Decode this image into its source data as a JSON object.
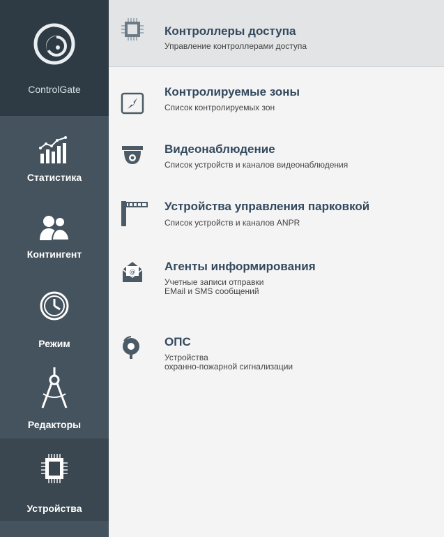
{
  "app": {
    "name": "ControlGate"
  },
  "sidebar": {
    "items": [
      {
        "label": "Статистика",
        "icon": "bar-chart-icon"
      },
      {
        "label": "Контингент",
        "icon": "people-icon"
      },
      {
        "label": "Режим",
        "icon": "clock-icon"
      },
      {
        "label": "Редакторы",
        "icon": "compass-icon"
      },
      {
        "label": "Устройства",
        "icon": "chip-icon",
        "active": true
      }
    ]
  },
  "main": {
    "items": [
      {
        "title": "Контроллеры доступа",
        "subtitle": [
          "Управление контроллерами доступа"
        ],
        "icon": "chip-icon",
        "selected": true
      },
      {
        "title": "Контролируемые зоны",
        "subtitle": [
          "Список контролируемых зон"
        ],
        "icon": "compass-icon"
      },
      {
        "title": "Видеонаблюдение",
        "subtitle": [
          "Список устройств и каналов видеонаблюдения"
        ],
        "icon": "camera-icon"
      },
      {
        "title": "Устройства управления парковкой",
        "subtitle": [
          "Список устройств и каналов ANPR"
        ],
        "icon": "barrier-icon"
      },
      {
        "title": "Агенты информирования",
        "subtitle": [
          "Учетные записи отправки",
          "EMail и SMS сообщений"
        ],
        "icon": "mail-icon"
      },
      {
        "title": "ОПС",
        "subtitle": [
          "Устройства",
          "охранно-пожарной сигнализации"
        ],
        "icon": "alarm-bell-icon"
      }
    ]
  },
  "colors": {
    "sidebar": "#45535e",
    "logo_bg": "#2f3b44",
    "accent_title": "#34495e",
    "selected_row": "#e2e4e6"
  }
}
